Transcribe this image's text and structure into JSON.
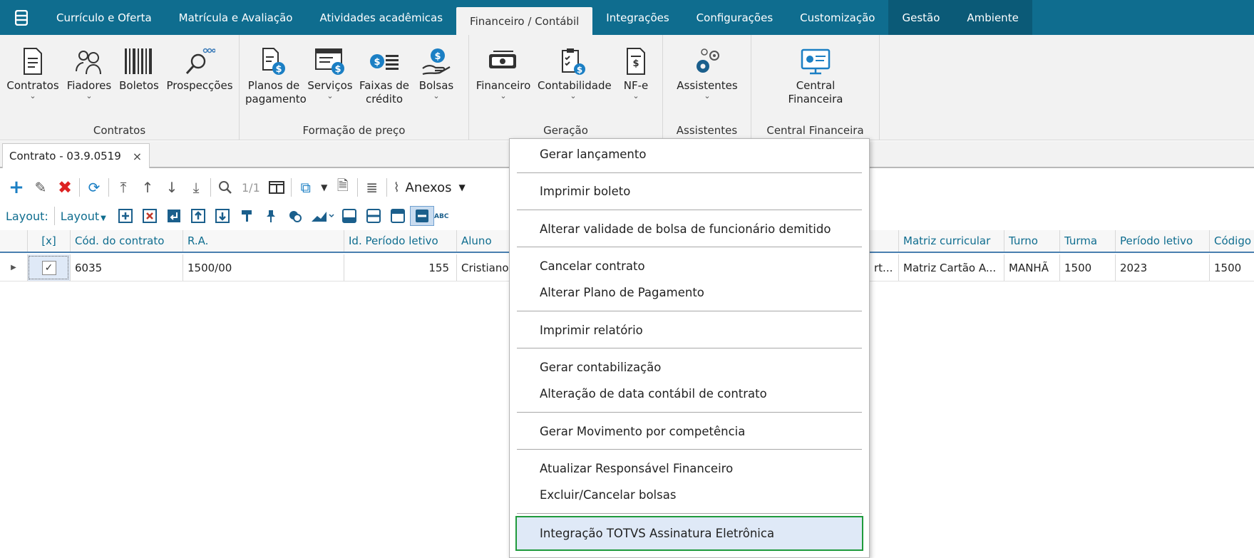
{
  "menubar": {
    "tabs": [
      "Currículo e Oferta",
      "Matrícula e Avaliação",
      "Atividades acadêmicas",
      "Financeiro / Contábil",
      "Integrações",
      "Configurações",
      "Customização",
      "Gestão",
      "Ambiente"
    ],
    "active_tab": "Financeiro / Contábil"
  },
  "ribbon": {
    "groups": {
      "contratos": {
        "label": "Contratos",
        "buttons": {
          "contratos": "Contratos",
          "fiadores": "Fiadores",
          "boletos": "Boletos",
          "prospeccoes": "Prospecções"
        }
      },
      "formacao": {
        "label": "Formação de preço",
        "buttons": {
          "planos_l1": "Planos de",
          "planos_l2": "pagamento",
          "servicos": "Serviços",
          "faixas_l1": "Faixas de",
          "faixas_l2": "crédito",
          "bolsas": "Bolsas"
        }
      },
      "geracao": {
        "label": "Geração",
        "buttons": {
          "financeiro": "Financeiro",
          "contabilidade": "Contabilidade",
          "nfe": "NF-e"
        }
      },
      "assistentes": {
        "label": "Assistentes",
        "buttons": {
          "assistentes": "Assistentes"
        }
      },
      "central": {
        "label": "Central Financeira",
        "buttons": {
          "central_l1": "Central",
          "central_l2": "Financeira"
        }
      }
    }
  },
  "doc_tab": {
    "title": "Contrato - 03.9.0519",
    "close": "×"
  },
  "toolbar": {
    "pager": "1/1",
    "anexos": "Anexos"
  },
  "layoutbar": {
    "label": "Layout:",
    "dropdown": "Layout"
  },
  "grid": {
    "headers": {
      "sel": "[x]",
      "cod": "Cód. do contrato",
      "ra": "R.A.",
      "periodo_id": "Id. Período letivo",
      "aluno": "Aluno",
      "matriz": "Matriz curricular",
      "turno": "Turno",
      "turma": "Turma",
      "periodo": "Período letivo",
      "codigo": "Código d"
    },
    "row": {
      "cod": "6035",
      "ra": "1500/00",
      "periodo_id": "155",
      "aluno": "Cristiano",
      "hidden_tail": "rt...",
      "matriz": "Matriz Cartão A...",
      "turno": "MANHÃ",
      "turma": "1500",
      "periodo": "2023",
      "codigo": "1500"
    }
  },
  "context_menu": {
    "items": [
      "Gerar lançamento",
      "Imprimir boleto",
      "Alterar validade de bolsa de funcionário demitido",
      "Cancelar contrato",
      "Alterar Plano de Pagamento",
      "Imprimir relatório",
      "Gerar contabilização",
      "Alteração de data contábil de contrato",
      "Gerar Movimento por competência",
      "Atualizar Responsável Financeiro",
      "Excluir/Cancelar bolsas",
      "Integração TOTVS Assinatura Eletrônica"
    ],
    "highlighted": "Integração TOTVS Assinatura Eletrônica"
  },
  "colors": {
    "menubar": "#0f6d8f",
    "ribbon": "#f2f2f2",
    "highlight_border": "#1f9a3c",
    "highlight_fill": "#dfe9f7"
  }
}
